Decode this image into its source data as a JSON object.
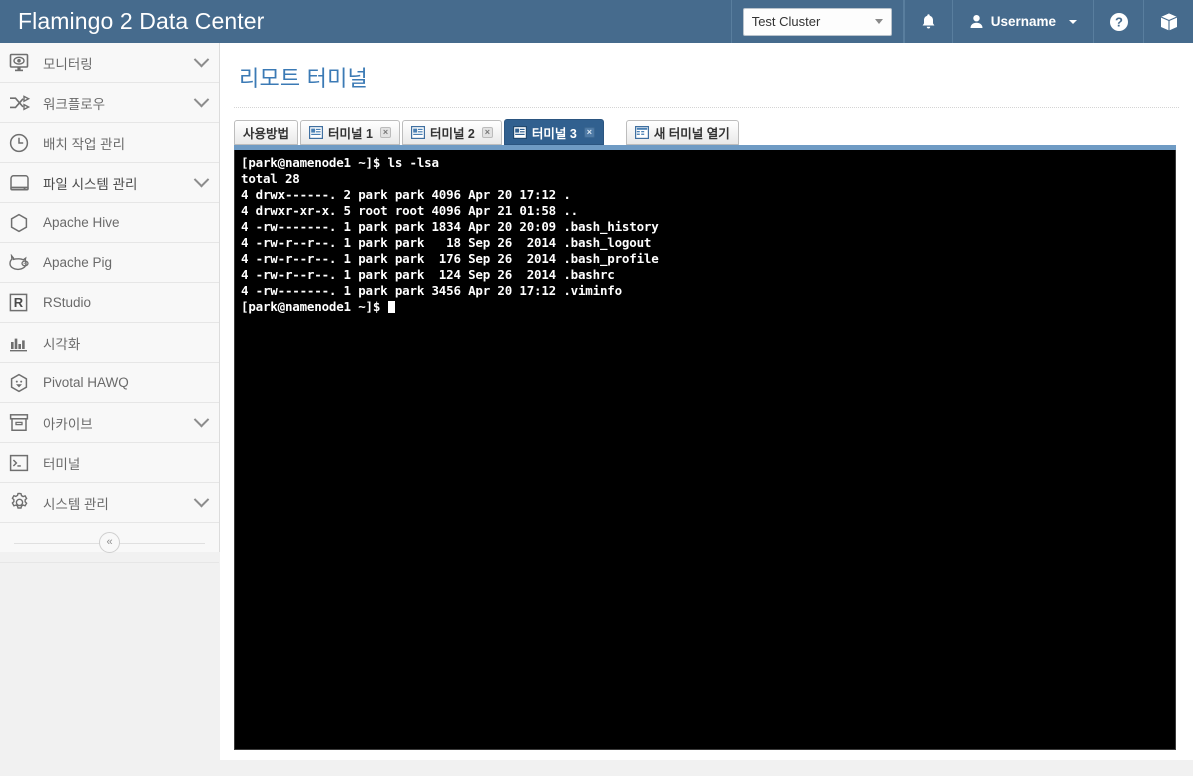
{
  "header": {
    "brand": "Flamingo 2 Data Center",
    "cluster_select": {
      "value": "Test Cluster",
      "icon": "chevron-down-icon"
    },
    "bell": {
      "icon": "bell-icon"
    },
    "user": {
      "label": "Username",
      "icon": "user-icon"
    },
    "help": {
      "icon": "help-circle-icon"
    },
    "cube": {
      "icon": "cube-icon"
    },
    "accent_color": "#466b8d"
  },
  "sidebar": {
    "items": [
      {
        "label": "모니터링",
        "icon": "monitor-eye-icon",
        "expandable": true,
        "highlight": false
      },
      {
        "label": "워크플로우",
        "icon": "workflow-icon",
        "expandable": true,
        "highlight": false
      },
      {
        "label": "배치 작업 관리",
        "icon": "clock-icon",
        "expandable": false,
        "highlight": false
      },
      {
        "label": "파일 시스템 관리",
        "icon": "drive-icon",
        "expandable": true,
        "highlight": true
      },
      {
        "label": "Apache Hive",
        "icon": "hexagon-icon",
        "expandable": false,
        "highlight": false
      },
      {
        "label": "Apache Pig",
        "icon": "pig-icon",
        "expandable": false,
        "highlight": false
      },
      {
        "label": "RStudio",
        "icon": "r-square-icon",
        "expandable": false,
        "highlight": false
      },
      {
        "label": "시각화",
        "icon": "bar-chart-icon",
        "expandable": false,
        "highlight": false
      },
      {
        "label": "Pivotal HAWQ",
        "icon": "hawq-hexagon-icon",
        "expandable": false,
        "highlight": false
      },
      {
        "label": "아카이브",
        "icon": "archive-box-icon",
        "expandable": true,
        "highlight": false
      },
      {
        "label": "터미널",
        "icon": "terminal-icon",
        "expandable": false,
        "highlight": false
      },
      {
        "label": "시스템 관리",
        "icon": "gear-icon",
        "expandable": true,
        "highlight": false
      }
    ],
    "collapse_button": {
      "glyph": "«",
      "icon": "collapse-sidebar-icon"
    }
  },
  "main": {
    "page_title": "리모트 터미널",
    "tabs": [
      {
        "label": "사용방법",
        "icon": null,
        "closable": false,
        "active": false
      },
      {
        "label": "터미널 1",
        "icon": "terminal-tab-icon",
        "closable": true,
        "active": false
      },
      {
        "label": "터미널 2",
        "icon": "terminal-tab-icon",
        "closable": true,
        "active": false
      },
      {
        "label": "터미널 3",
        "icon": "terminal-tab-icon",
        "closable": true,
        "active": true
      },
      {
        "label": "새 터미널 열기",
        "icon": "new-terminal-icon",
        "closable": false,
        "active": false,
        "is_new": true
      }
    ],
    "close_glyph": "×",
    "terminal": {
      "lines": [
        "[park@namenode1 ~]$ ls -lsa",
        "total 28",
        "4 drwx------. 2 park park 4096 Apr 20 17:12 .",
        "4 drwxr-xr-x. 5 root root 4096 Apr 21 01:58 ..",
        "4 -rw-------. 1 park park 1834 Apr 20 20:09 .bash_history",
        "4 -rw-r--r--. 1 park park   18 Sep 26  2014 .bash_logout",
        "4 -rw-r--r--. 1 park park  176 Sep 26  2014 .bash_profile",
        "4 -rw-r--r--. 1 park park  124 Sep 26  2014 .bashrc",
        "4 -rw-------. 1 park park 3456 Apr 20 17:12 .viminfo"
      ],
      "prompt": "[park@namenode1 ~]$ ",
      "background": "#000000",
      "text_color": "#ffffff"
    }
  }
}
